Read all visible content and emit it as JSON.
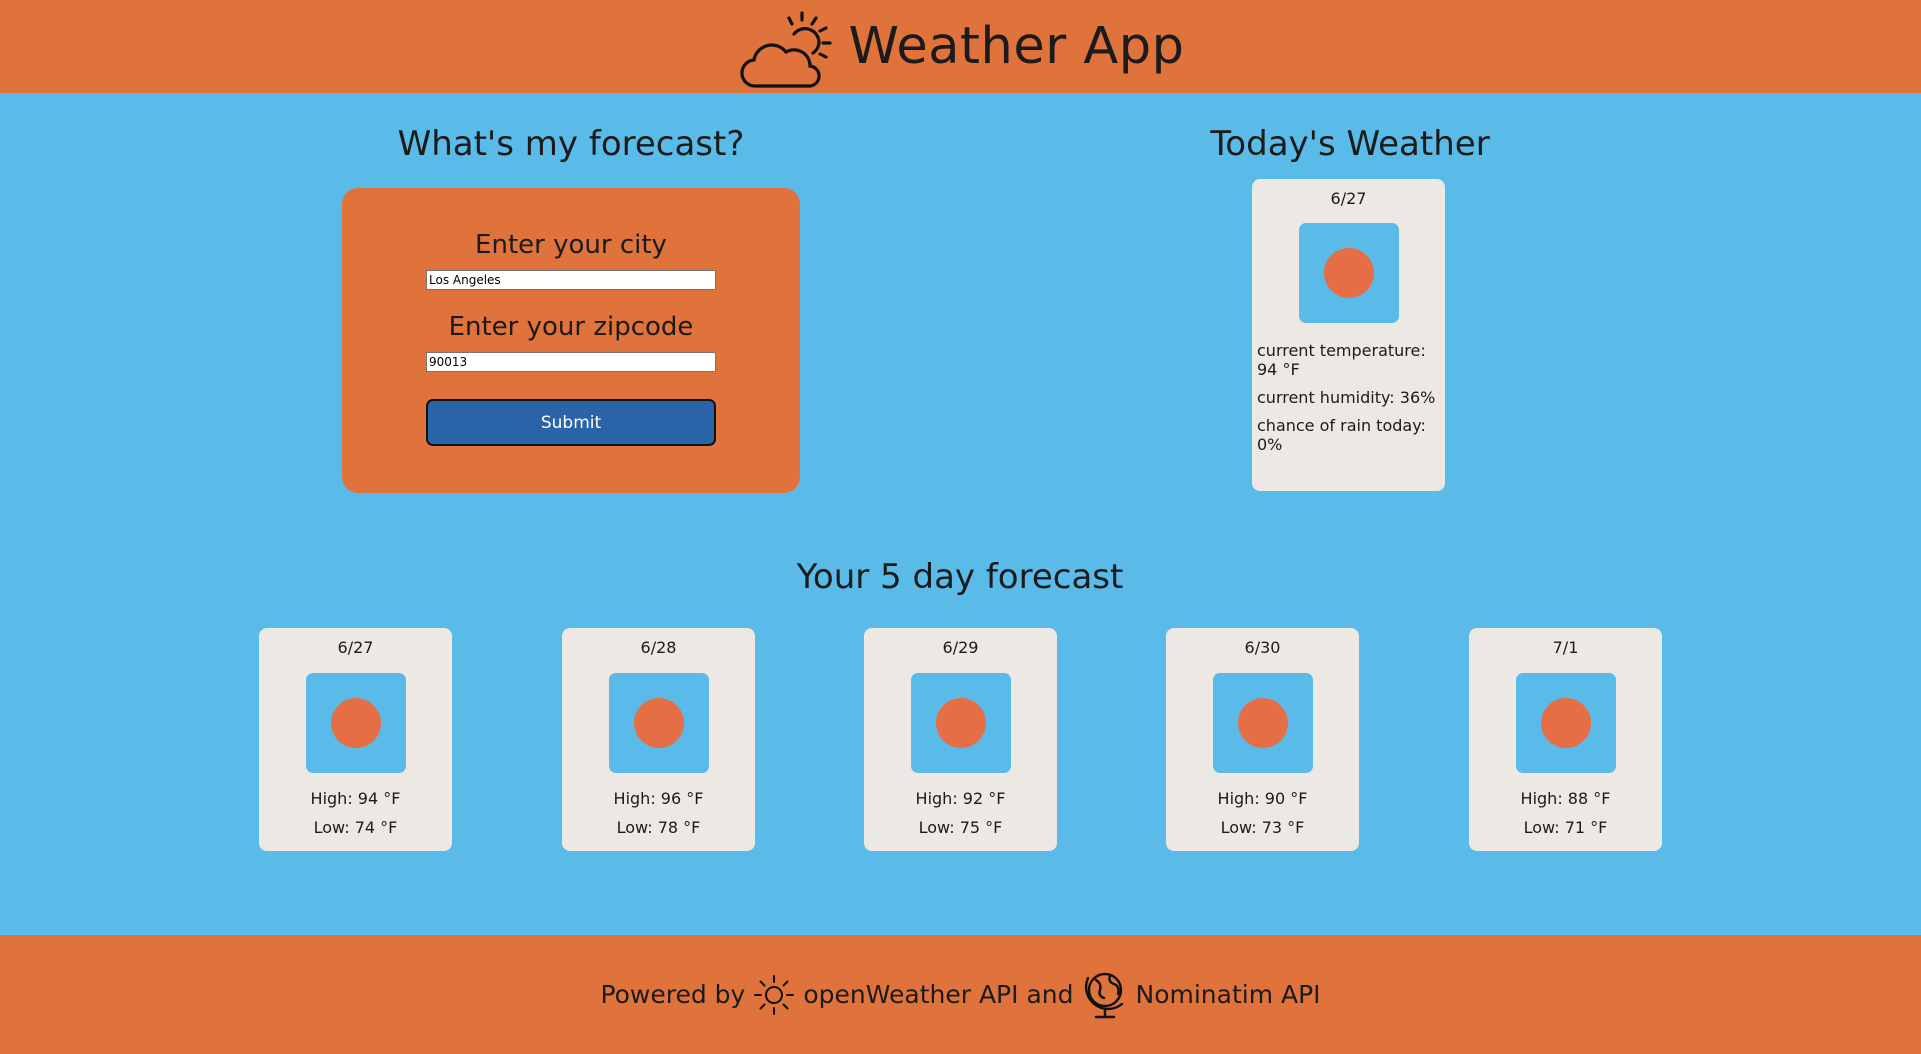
{
  "header": {
    "title": "Weather App",
    "logo_icon": "cloud-sun-icon"
  },
  "forecast_form": {
    "title": "What's my forecast?",
    "city_label": "Enter your city",
    "city_value": "Los Angeles",
    "zip_label": "Enter your zipcode",
    "zip_value": "90013",
    "submit_label": "Submit"
  },
  "today": {
    "title": "Today's Weather",
    "date": "6/27",
    "icon": "sun-icon",
    "temperature": "current temperature: 94 °F",
    "humidity": "current humidity: 36%",
    "rain": "chance of rain today: 0%"
  },
  "five_day": {
    "title": "Your 5 day forecast",
    "days": [
      {
        "date": "6/27",
        "high": "High: 94 °F",
        "low": "Low: 74 °F",
        "icon": "sun-icon"
      },
      {
        "date": "6/28",
        "high": "High: 96 °F",
        "low": "Low: 78 °F",
        "icon": "sun-icon"
      },
      {
        "date": "6/29",
        "high": "High: 92 °F",
        "low": "Low: 75 °F",
        "icon": "sun-icon"
      },
      {
        "date": "6/30",
        "high": "High: 90 °F",
        "low": "Low: 73 °F",
        "icon": "sun-icon"
      },
      {
        "date": "7/1",
        "high": "High: 88 °F",
        "low": "Low: 71 °F",
        "icon": "sun-icon"
      }
    ]
  },
  "footer": {
    "powered_by": "Powered by",
    "api1": "openWeather API",
    "and": "and",
    "api2": "Nominatim API",
    "api1_icon": "sun-outline-icon",
    "api2_icon": "globe-icon"
  },
  "colors": {
    "header_bg": "#e0733b",
    "main_bg": "#5bbbe8",
    "card_bg": "#ece8e3",
    "sun": "#e66e45",
    "button": "#2a64a8"
  }
}
